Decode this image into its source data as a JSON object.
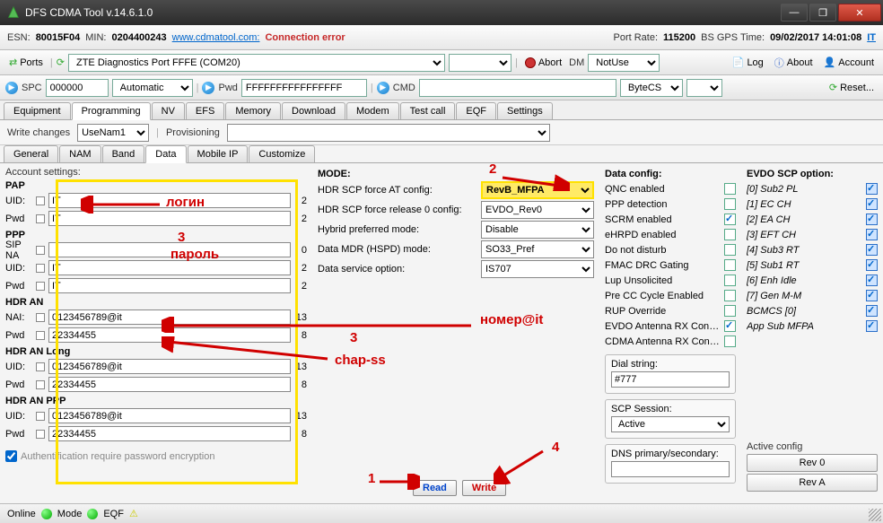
{
  "window": {
    "title": "DFS CDMA Tool v.14.6.1.0"
  },
  "info": {
    "esn_lbl": "ESN:",
    "esn": "80015F04",
    "min_lbl": "MIN:",
    "min": "0204400243",
    "url": "www.cdmatool.com:",
    "status": "Connection error",
    "portrate_lbl": "Port Rate:",
    "portrate": "115200",
    "gps_lbl": "BS GPS Time:",
    "gps": "09/02/2017 14:01:08",
    "it": "IT"
  },
  "tb1": {
    "ports": "Ports",
    "portsel": "ZTE Diagnostics Port FFFE (COM20)",
    "abort": "Abort",
    "dm": "DM",
    "dmval": "NotUse",
    "log": "Log",
    "about": "About",
    "account": "Account"
  },
  "tb2": {
    "spc_lbl": "SPC",
    "spc": "000000",
    "spc_mode": "Automatic",
    "pwd_lbl": "Pwd",
    "pwd": "FFFFFFFFFFFFFFFF",
    "cmd_lbl": "CMD",
    "cmd": "",
    "bytecs": "ByteCS",
    "reset": "Reset..."
  },
  "tabs": [
    "Equipment",
    "Programming",
    "NV",
    "EFS",
    "Memory",
    "Download",
    "Modem",
    "Test call",
    "EQF",
    "Settings"
  ],
  "tabs_active": 1,
  "sec": {
    "write": "Write changes",
    "usenam": "UseNam1",
    "prov": "Provisioning",
    "provval": ""
  },
  "subtabs": [
    "General",
    "NAM",
    "Band",
    "Data",
    "Mobile IP",
    "Customize"
  ],
  "subtabs_active": 3,
  "acct": {
    "header": "Account settings:",
    "pap": "PAP",
    "ppp": "PPP",
    "hdran": "HDR AN",
    "hdrlong": "HDR AN Long",
    "hdrppp": "HDR AN PPP",
    "uid": "UID:",
    "pwd": "Pwd",
    "sip": "SIP NA",
    "nai": "NAI:",
    "pap_uid": "IT",
    "pap_uid_n": "2",
    "pap_pwd": "IT",
    "pap_pwd_n": "2",
    "ppp_sip": "",
    "ppp_sip_n": "0",
    "ppp_uid": "IT",
    "ppp_uid_n": "2",
    "ppp_pwd": "IT",
    "ppp_pwd_n": "2",
    "an_nai": "0123456789@it",
    "an_nai_n": "13",
    "an_pwd": "22334455",
    "an_pwd_n": "8",
    "lg_uid": "0123456789@it",
    "lg_uid_n": "13",
    "lg_pwd": "22334455",
    "lg_pwd_n": "8",
    "pp_uid": "0123456789@it",
    "pp_uid_n": "13",
    "pp_pwd": "22334455",
    "pp_pwd_n": "8",
    "authchk": "Authentification require password encryption"
  },
  "mode": {
    "header": "MODE:",
    "r1": "HDR SCP force AT config:",
    "v1": "RevB_MFPA",
    "r2": "HDR SCP force release 0 config:",
    "v2": "EVDO_Rev0",
    "r3": "Hybrid preferred mode:",
    "v3": "Disable",
    "r4": "Data MDR (HSPD) mode:",
    "v4": "SO33_Pref",
    "r5": "Data service option:",
    "v5": "IS707"
  },
  "dc": {
    "header": "Data config:",
    "items": [
      {
        "l": "QNC enabled",
        "on": false
      },
      {
        "l": "PPP detection",
        "on": false
      },
      {
        "l": "SCRM enabled",
        "on": true
      },
      {
        "l": "eHRPD enabled",
        "on": false
      },
      {
        "l": "Do not disturb",
        "on": false
      },
      {
        "l": "FMAC DRC Gating",
        "on": false
      },
      {
        "l": "Lup Unsolicited",
        "on": false
      },
      {
        "l": "Pre CC Cycle Enabled",
        "on": false
      },
      {
        "l": "RUP Override",
        "on": false
      },
      {
        "l": "EVDO Antenna RX Control",
        "on": true
      },
      {
        "l": "CDMA Antenna RX Control",
        "on": false
      }
    ],
    "dial_lbl": "Dial string:",
    "dial": "#777",
    "scp_lbl": "SCP Session:",
    "scp": "Active",
    "dns_lbl": "DNS primary/secondary:",
    "dns": ""
  },
  "scp": {
    "header": "EVDO SCP option:",
    "items": [
      {
        "l": "[0] Sub2 PL"
      },
      {
        "l": "[1] EC CH"
      },
      {
        "l": "[2] EA CH"
      },
      {
        "l": "[3] EFT CH"
      },
      {
        "l": "[4] Sub3 RT"
      },
      {
        "l": "[5] Sub1 RT"
      },
      {
        "l": "[6] Enh Idle"
      },
      {
        "l": "[7] Gen M-M"
      },
      {
        "l": "BCMCS [0]"
      },
      {
        "l": "App Sub MFPA"
      }
    ],
    "active_lbl": "Active config",
    "rev0": "Rev 0",
    "reva": "Rev A"
  },
  "rw": {
    "read": "Read",
    "write": "Write"
  },
  "ann": {
    "login": "логин",
    "parol": "пароль",
    "n3a": "3",
    "n3b": "3",
    "nomer": "номер@it",
    "chap": "chap-ss",
    "n1": "1",
    "n2": "2",
    "n4": "4"
  },
  "status": {
    "online": "Online",
    "mode": "Mode",
    "eqf": "EQF"
  }
}
